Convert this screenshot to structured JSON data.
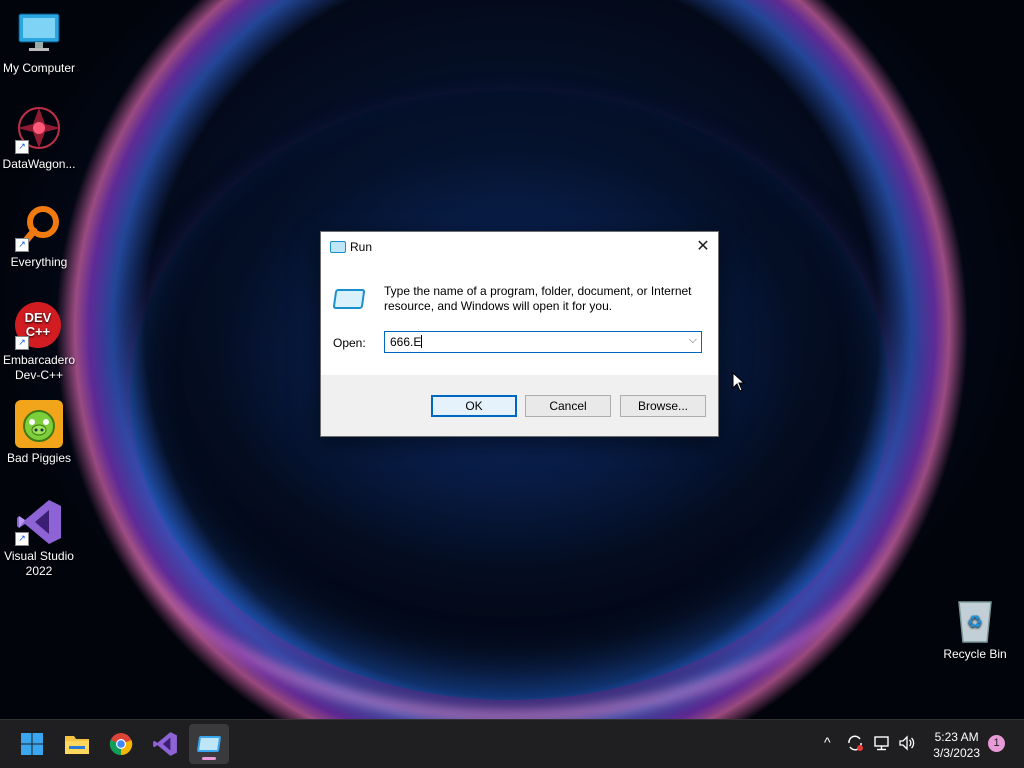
{
  "desktop": {
    "icons": [
      {
        "label": "My Computer",
        "icon": "monitor-icon"
      },
      {
        "label": "DataWagon...",
        "icon": "datawagon-icon"
      },
      {
        "label": "Everything",
        "icon": "everything-search-icon"
      },
      {
        "label": "Embarcadero Dev-C++",
        "icon": "devcpp-icon",
        "glyph": "DEV C++"
      },
      {
        "label": "Bad Piggies",
        "icon": "bad-piggies-icon"
      },
      {
        "label": "Visual Studio 2022",
        "icon": "visual-studio-icon"
      },
      {
        "label": "Recycle Bin",
        "icon": "recycle-bin-icon"
      }
    ],
    "shortcut_arrow": "↗"
  },
  "run_dialog": {
    "title": "Run",
    "close_glyph": "✕",
    "description": "Type the name of a program, folder, document, or Internet resource, and Windows will open it for you.",
    "open_label": "Open:",
    "open_value": "666.E",
    "dropdown_glyph": "⌵",
    "ok_label": "OK",
    "cancel_label": "Cancel",
    "browse_label": "Browse..."
  },
  "taskbar": {
    "items": [
      {
        "name": "start",
        "icon": "windows-start-icon"
      },
      {
        "name": "file-explorer",
        "icon": "folder-icon"
      },
      {
        "name": "chrome",
        "icon": "chrome-icon"
      },
      {
        "name": "visual-studio",
        "icon": "visual-studio-icon"
      },
      {
        "name": "run",
        "icon": "run-icon",
        "active": true
      }
    ],
    "tray": {
      "chevron": "^",
      "time": "5:23 AM",
      "date": "3/3/2023",
      "notification_count": "1"
    }
  },
  "colors": {
    "accent": "#0067c0",
    "taskbar": "#1f1f22",
    "indicator": "#e79ad6"
  }
}
